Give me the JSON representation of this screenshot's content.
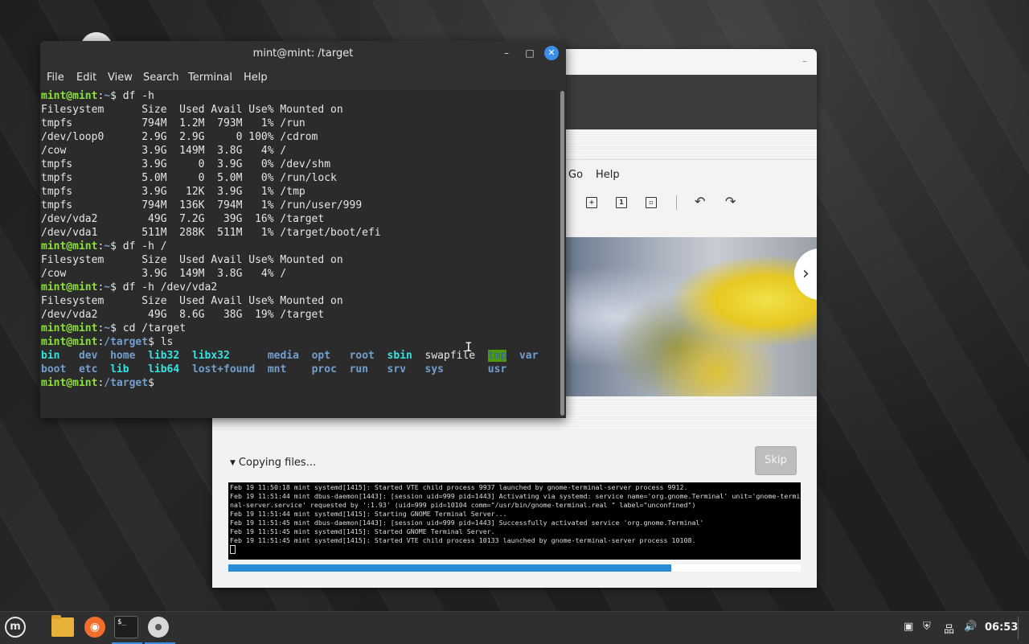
{
  "terminal": {
    "title": "mint@mint: /target",
    "menu": [
      "File",
      "Edit",
      "View",
      "Search",
      "Terminal",
      "Help"
    ],
    "user_host": "mint@mint",
    "lines": [
      {
        "type": "prompt",
        "path": "~",
        "cmd": "df -h"
      },
      {
        "type": "text",
        "text": "Filesystem      Size  Used Avail Use% Mounted on"
      },
      {
        "type": "text",
        "text": "tmpfs           794M  1.2M  793M   1% /run"
      },
      {
        "type": "text",
        "text": "/dev/loop0      2.9G  2.9G     0 100% /cdrom"
      },
      {
        "type": "text",
        "text": "/cow            3.9G  149M  3.8G   4% /"
      },
      {
        "type": "text",
        "text": "tmpfs           3.9G     0  3.9G   0% /dev/shm"
      },
      {
        "type": "text",
        "text": "tmpfs           5.0M     0  5.0M   0% /run/lock"
      },
      {
        "type": "text",
        "text": "tmpfs           3.9G   12K  3.9G   1% /tmp"
      },
      {
        "type": "text",
        "text": "tmpfs           794M  136K  794M   1% /run/user/999"
      },
      {
        "type": "text",
        "text": "/dev/vda2        49G  7.2G   39G  16% /target"
      },
      {
        "type": "text",
        "text": "/dev/vda1       511M  288K  511M   1% /target/boot/efi"
      },
      {
        "type": "prompt",
        "path": "~",
        "cmd": "df -h /"
      },
      {
        "type": "text",
        "text": "Filesystem      Size  Used Avail Use% Mounted on"
      },
      {
        "type": "text",
        "text": "/cow            3.9G  149M  3.8G   4% /"
      },
      {
        "type": "prompt",
        "path": "~",
        "cmd": "df -h /dev/vda2"
      },
      {
        "type": "text",
        "text": "Filesystem      Size  Used Avail Use% Mounted on"
      },
      {
        "type": "text",
        "text": "/dev/vda2        49G  8.6G   38G  19% /target"
      },
      {
        "type": "prompt",
        "path": "~",
        "cmd": "cd /target"
      },
      {
        "type": "prompt",
        "path": "/target",
        "cmd": "ls"
      },
      {
        "type": "ls",
        "row": [
          {
            "t": "bin",
            "c": "dirc"
          },
          {
            "t": "   "
          },
          {
            "t": "dev",
            "c": "dirb"
          },
          {
            "t": "  "
          },
          {
            "t": "home",
            "c": "dirb"
          },
          {
            "t": "  "
          },
          {
            "t": "lib32",
            "c": "dirc"
          },
          {
            "t": "  "
          },
          {
            "t": "libx32",
            "c": "dirc"
          },
          {
            "t": "      "
          },
          {
            "t": "media",
            "c": "dirb"
          },
          {
            "t": "  "
          },
          {
            "t": "opt",
            "c": "dirb"
          },
          {
            "t": "   "
          },
          {
            "t": "root",
            "c": "dirb"
          },
          {
            "t": "  "
          },
          {
            "t": "sbin",
            "c": "dirc"
          },
          {
            "t": "  "
          },
          {
            "t": "swapfile"
          },
          {
            "t": "  "
          },
          {
            "t": "tmp",
            "c": "tmpd"
          },
          {
            "t": "  "
          },
          {
            "t": "var",
            "c": "dirb"
          }
        ]
      },
      {
        "type": "ls",
        "row": [
          {
            "t": "boot",
            "c": "dirb"
          },
          {
            "t": "  "
          },
          {
            "t": "etc",
            "c": "dirb"
          },
          {
            "t": "  "
          },
          {
            "t": "lib",
            "c": "dirc"
          },
          {
            "t": "   "
          },
          {
            "t": "lib64",
            "c": "dirc"
          },
          {
            "t": "  "
          },
          {
            "t": "lost+found",
            "c": "dirb"
          },
          {
            "t": "  "
          },
          {
            "t": "mnt",
            "c": "dirb"
          },
          {
            "t": "    "
          },
          {
            "t": "proc",
            "c": "dirb"
          },
          {
            "t": "  "
          },
          {
            "t": "run",
            "c": "dirb"
          },
          {
            "t": "   "
          },
          {
            "t": "srv",
            "c": "dirb"
          },
          {
            "t": "   "
          },
          {
            "t": "sys",
            "c": "dirb"
          },
          {
            "t": "       "
          },
          {
            "t": "usr",
            "c": "dirb"
          }
        ]
      },
      {
        "type": "prompt",
        "path": "/target",
        "cmd": ""
      }
    ]
  },
  "viewer": {
    "menu": [
      "Go",
      "Help"
    ],
    "tool_icons": [
      "zoom-fit-icon",
      "zoom-1-icon",
      "zoom-best-icon",
      "rotate-left-icon",
      "rotate-right-icon"
    ],
    "next_glyph": "›"
  },
  "installer": {
    "status_label": "Copying files...",
    "skip_label": "Skip",
    "progress_fraction": 0.774,
    "log_lines": [
      "Feb 19 11:50:18 mint systemd[1415]: Started VTE child process 9937 launched by gnome-terminal-server process 9912.",
      "Feb 19 11:51:44 mint dbus-daemon[1443]: [session uid=999 pid=1443] Activating via systemd: service name='org.gnome.Terminal' unit='gnome-termi",
      "nal-server.service' requested by ':1.93' (uid=999 pid=10104 comm=\"/usr/bin/gnome-terminal.real \" label=\"unconfined\")",
      "Feb 19 11:51:44 mint systemd[1415]: Starting GNOME Terminal Server...",
      "Feb 19 11:51:45 mint dbus-daemon[1443]: [session uid=999 pid=1443] Successfully activated service 'org.gnome.Terminal'",
      "Feb 19 11:51:45 mint systemd[1415]: Started GNOME Terminal Server.",
      "Feb 19 11:51:45 mint systemd[1415]: Started VTE child process 10133 launched by gnome-terminal-server process 10108."
    ]
  },
  "taskbar": {
    "clock": "06:53",
    "terminal_icon_text": "$_",
    "tray_icons": [
      "clipboard-icon",
      "shield-update-icon",
      "network-icon",
      "volume-icon"
    ]
  }
}
